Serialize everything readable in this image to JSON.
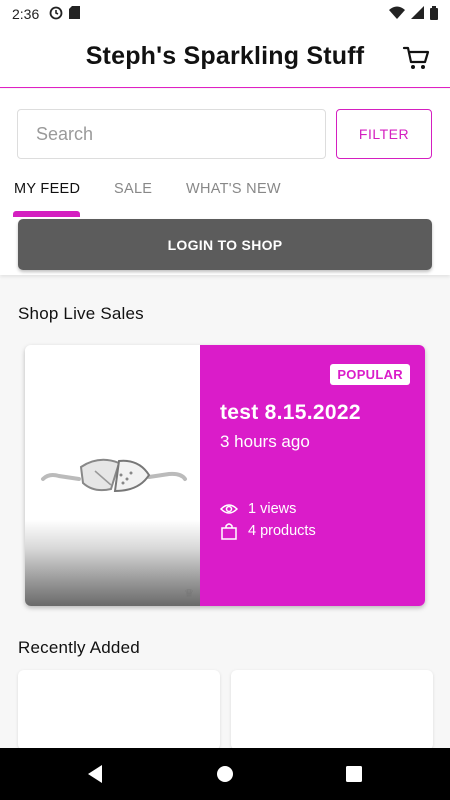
{
  "status_bar": {
    "time": "2:36",
    "icons": [
      "sync-icon",
      "sd-card-icon",
      "wifi-icon",
      "signal-icon",
      "battery-icon"
    ]
  },
  "header": {
    "title": "Steph's Sparkling Stuff",
    "cart_icon": "cart-icon"
  },
  "search": {
    "placeholder": "Search",
    "value": ""
  },
  "filter_label": "FILTER",
  "tabs": [
    {
      "label": "MY FEED",
      "active": true
    },
    {
      "label": "SALE",
      "active": false
    },
    {
      "label": "WHAT'S NEW",
      "active": false
    }
  ],
  "login_label": "LOGIN TO SHOP",
  "sections": {
    "live_sales": "Shop Live Sales",
    "recently_added": "Recently Added"
  },
  "live_sale": {
    "badge": "POPULAR",
    "name": "test 8.15.2022",
    "time": "3 hours ago",
    "views": "1 views",
    "products": "4 products",
    "image": "silver-ring-product-photo"
  },
  "colors": {
    "accent": "#da1cc9",
    "login_button": "#5c5c5c",
    "background": "#f7f7f7"
  },
  "nav": [
    "back-icon",
    "home-icon",
    "recents-icon"
  ]
}
